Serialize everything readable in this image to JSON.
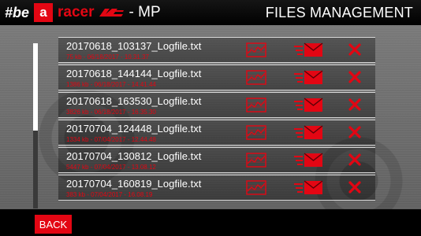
{
  "header": {
    "brand_be": "#be",
    "brand_a": "a",
    "brand_racer": "racer",
    "brand_suffix": "- MP",
    "title": "FILES MANAGEMENT"
  },
  "files": [
    {
      "name": "20170618_103137_Logfile.txt",
      "meta": "75 kb - 06/18/2017 - 10.31.37"
    },
    {
      "name": "20170618_144144_Logfile.txt",
      "meta": "1386 kb - 06/18/2017 - 14.41.44"
    },
    {
      "name": "20170618_163530_Logfile.txt",
      "meta": "3826 kb - 06/18/2017 - 16.35.30"
    },
    {
      "name": "20170704_124448_Logfile.txt",
      "meta": "1334 kb - 07/04/2017 - 12.44.48"
    },
    {
      "name": "20170704_130812_Logfile.txt",
      "meta": "5447 kb - 07/04/2017 - 13.08.12"
    },
    {
      "name": "20170704_160819_Logfile.txt",
      "meta": "383 kb - 07/04/2017 - 16.08.19"
    }
  ],
  "row_icons": {
    "view": "chart-icon",
    "send": "mail-icon",
    "delete": "delete-icon"
  },
  "scroll": {
    "visible_fraction": 0.53,
    "position": 0.0
  },
  "footer": {
    "back_label": "BACK"
  },
  "colors": {
    "accent": "#e30613",
    "text": "#ffffff",
    "bar": "#000000"
  }
}
